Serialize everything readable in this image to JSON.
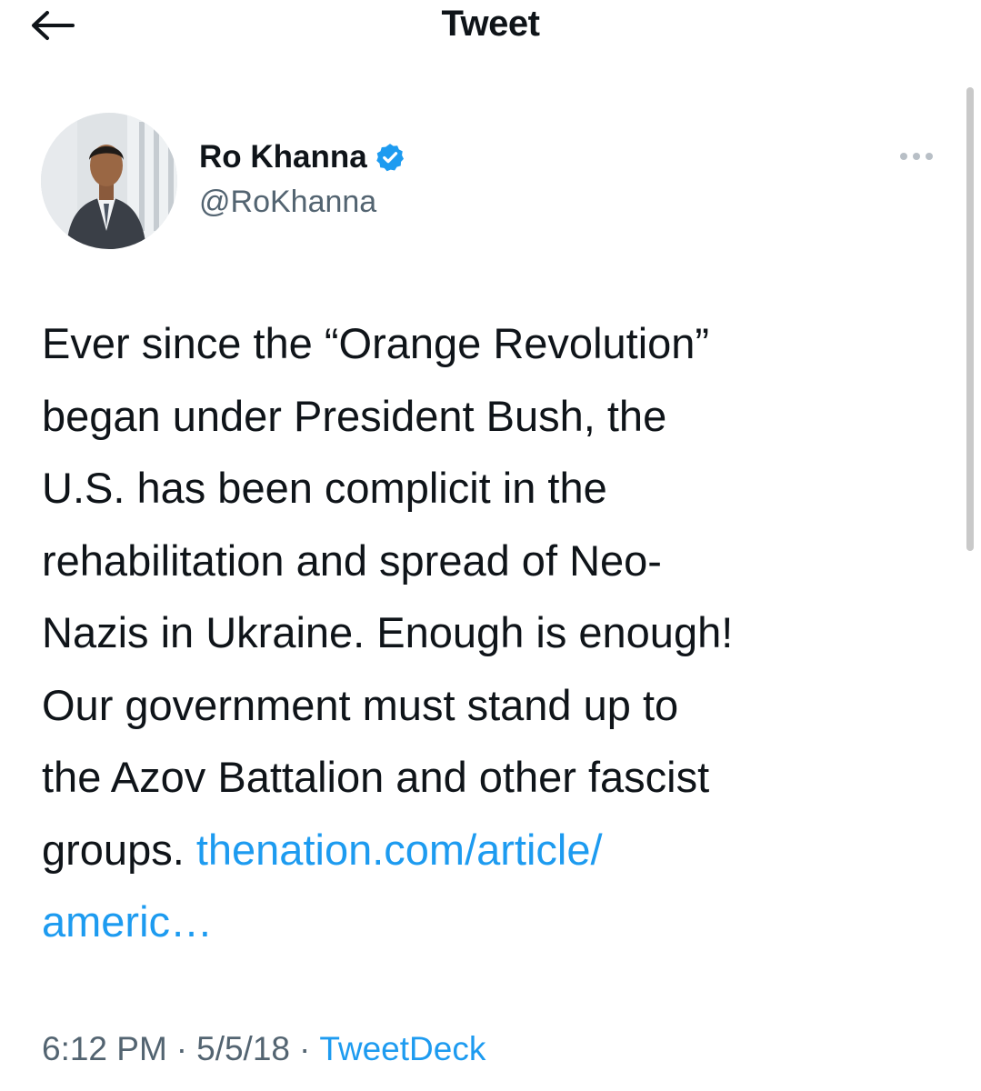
{
  "header": {
    "title": "Tweet",
    "back_icon": "arrow-left-icon"
  },
  "author": {
    "display_name": "Ro Khanna",
    "handle": "@RoKhanna",
    "verified": true,
    "verified_color": "#1d9bf0"
  },
  "tweet": {
    "text_lines": [
      "Ever since the “Orange Revolution”",
      "began under President Bush, the",
      "U.S. has been complicit in the",
      "rehabilitation and spread of Neo-",
      "Nazis in Ukraine. Enough is enough!",
      "Our government must stand up to",
      "the Azov Battalion and other fascist"
    ],
    "last_line_prefix": "groups. ",
    "link_line1": "thenation.com/article/",
    "link_line2": "americ…"
  },
  "meta": {
    "time": "6:12 PM",
    "separator": "·",
    "date": "5/5/18",
    "source": "TweetDeck"
  },
  "colors": {
    "link": "#1d9bf0",
    "secondary_text": "#536471",
    "primary_text": "#0f1419"
  }
}
